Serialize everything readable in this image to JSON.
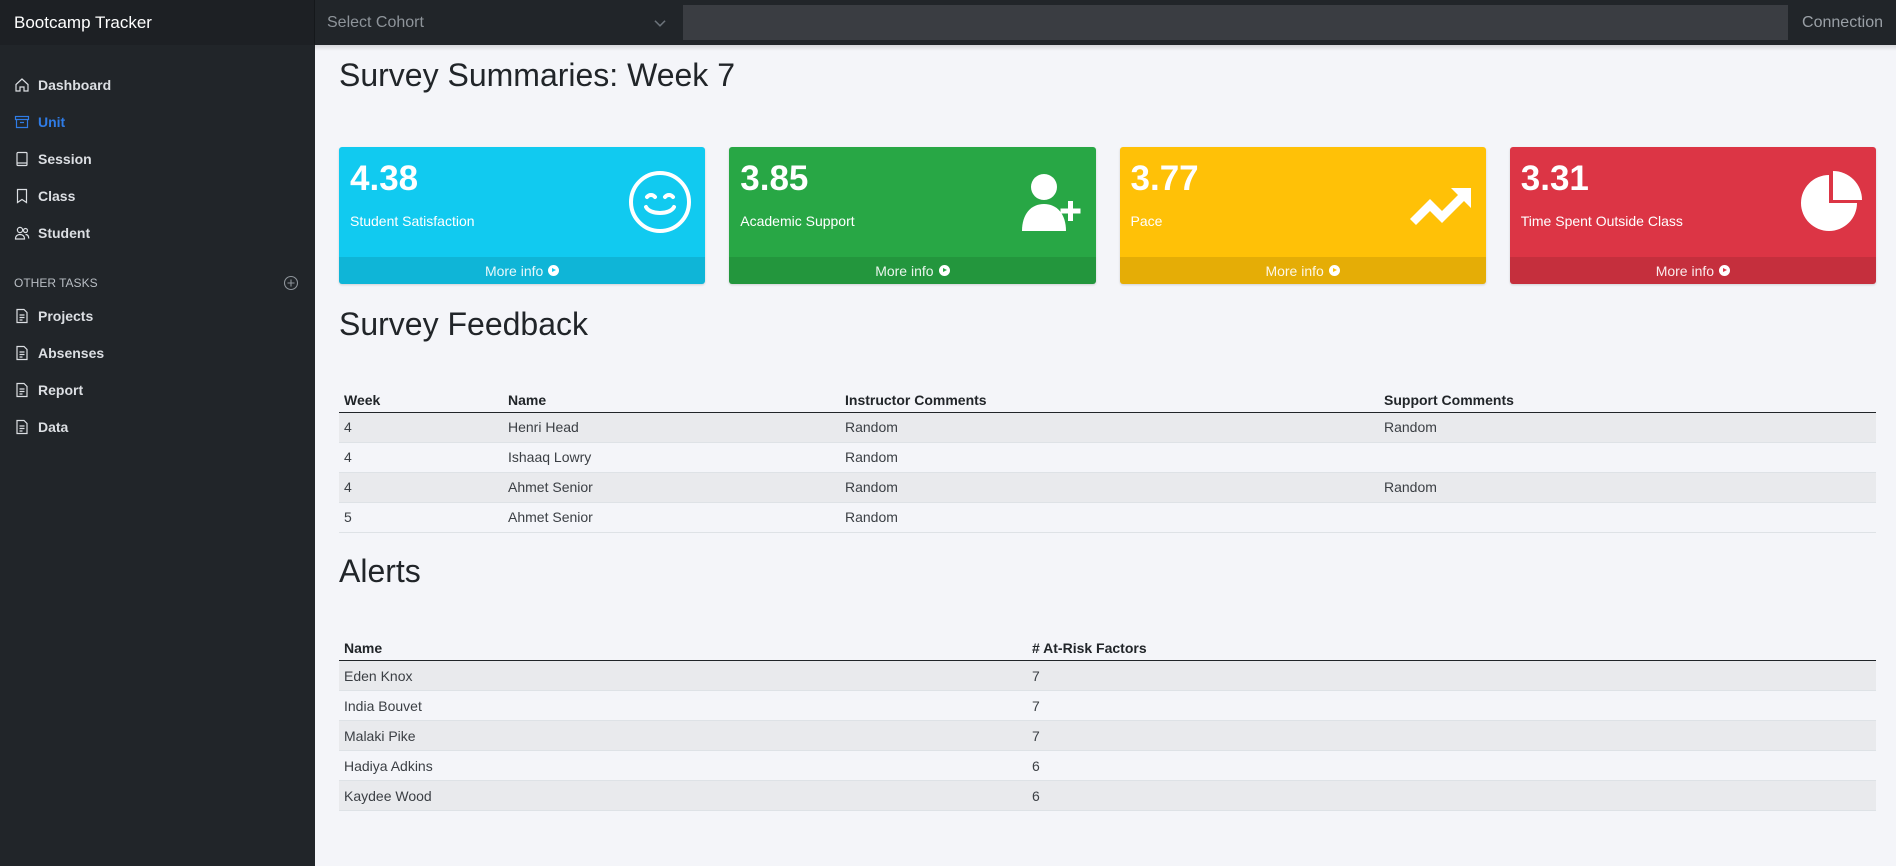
{
  "app": {
    "title": "Bootcamp Tracker",
    "cohort_placeholder": "Select Cohort",
    "search_value": "",
    "connection_label": "Connection"
  },
  "sidebar": {
    "items": [
      {
        "label": "Dashboard",
        "icon": "home-icon"
      },
      {
        "label": "Unit",
        "icon": "archive-icon",
        "active": true
      },
      {
        "label": "Session",
        "icon": "book-icon"
      },
      {
        "label": "Class",
        "icon": "bookmark-icon"
      },
      {
        "label": "Student",
        "icon": "people-icon"
      }
    ],
    "other_heading": "OTHER TASKS",
    "other_items": [
      {
        "label": "Projects",
        "icon": "file-text-icon"
      },
      {
        "label": "Absenses",
        "icon": "file-text-icon"
      },
      {
        "label": "Report",
        "icon": "file-text-icon"
      },
      {
        "label": "Data",
        "icon": "file-text-icon"
      }
    ]
  },
  "main": {
    "title": "Survey Summaries: Week 7",
    "cards": [
      {
        "value": "4.38",
        "label": "Student Satisfaction",
        "footer": "More info",
        "icon": "smile-icon",
        "color": "#11caf0"
      },
      {
        "value": "3.85",
        "label": "Academic Support",
        "footer": "More info",
        "icon": "person-plus-icon",
        "color": "#28a745"
      },
      {
        "value": "3.77",
        "label": "Pace",
        "footer": "More info",
        "icon": "trending-up-icon",
        "color": "#ffc107"
      },
      {
        "value": "3.31",
        "label": "Time Spent Outside Class",
        "footer": "More info",
        "icon": "pie-chart-icon",
        "color": "#dc3545"
      }
    ],
    "feedback": {
      "title": "Survey Feedback",
      "headers": [
        "Week",
        "Name",
        "Instructor Comments",
        "Support Comments"
      ],
      "rows": [
        [
          "4",
          "Henri Head",
          "Random",
          "Random"
        ],
        [
          "4",
          "Ishaaq Lowry",
          "Random",
          ""
        ],
        [
          "4",
          "Ahmet Senior",
          "Random",
          "Random"
        ],
        [
          "5",
          "Ahmet Senior",
          "Random",
          ""
        ]
      ]
    },
    "alerts": {
      "title": "Alerts",
      "headers": [
        "Name",
        "# At-Risk Factors"
      ],
      "rows": [
        [
          "Eden Knox",
          "7"
        ],
        [
          "India Bouvet",
          "7"
        ],
        [
          "Malaki Pike",
          "7"
        ],
        [
          "Hadiya Adkins",
          "6"
        ],
        [
          "Kaydee Wood",
          "6"
        ]
      ]
    }
  }
}
